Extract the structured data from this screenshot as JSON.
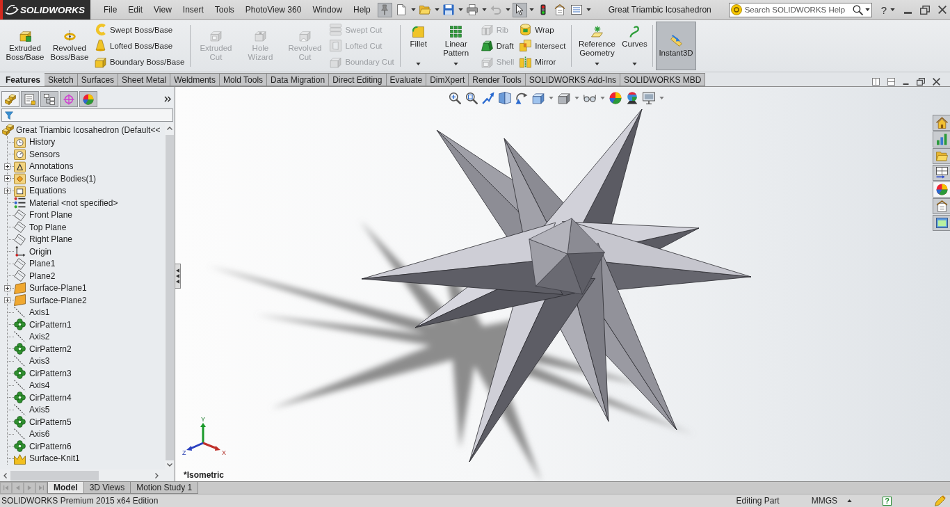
{
  "title_bar": {
    "logo": "SOLIDWORKS",
    "menu": [
      "File",
      "Edit",
      "View",
      "Insert",
      "Tools",
      "PhotoView 360",
      "Window",
      "Help"
    ],
    "quick_access": [
      {
        "selected": true,
        "disabled": false,
        "dropdown": false
      },
      {
        "selected": false,
        "disabled": false,
        "dropdown": true
      },
      {
        "selected": false,
        "disabled": false,
        "dropdown": true
      },
      {
        "selected": false,
        "disabled": false,
        "dropdown": true
      },
      {
        "selected": false,
        "disabled": false,
        "dropdown": true
      },
      {
        "selected": false,
        "disabled": true,
        "dropdown": true
      },
      {
        "selected": true,
        "disabled": false,
        "dropdown": true
      },
      {
        "selected": false,
        "disabled": false,
        "dropdown": false
      },
      {
        "selected": false,
        "disabled": false,
        "dropdown": false
      },
      {
        "selected": false,
        "disabled": false,
        "dropdown": true
      }
    ],
    "document_title": "Great Triambic Icosahedron",
    "search": {
      "placeholder": "Search SOLIDWORKS Help"
    },
    "help_glyph": "?"
  },
  "ribbon": {
    "groups": [
      {
        "columns": [
          {
            "kind": "large",
            "label": "Extruded Boss/Base",
            "disabled": false,
            "dropdown": false
          },
          {
            "kind": "large",
            "label": "Revolved Boss/Base",
            "disabled": false,
            "dropdown": false
          },
          {
            "kind": "stack",
            "items": [
              {
                "label": "Swept Boss/Base",
                "disabled": false
              },
              {
                "label": "Lofted Boss/Base",
                "disabled": false
              },
              {
                "label": "Boundary Boss/Base",
                "disabled": false
              }
            ]
          }
        ]
      },
      {
        "columns": [
          {
            "kind": "large",
            "label": "Extruded Cut",
            "disabled": true,
            "dropdown": false
          },
          {
            "kind": "large",
            "label": "Hole Wizard",
            "disabled": true,
            "dropdown": false
          },
          {
            "kind": "large",
            "label": "Revolved Cut",
            "disabled": true,
            "dropdown": false
          },
          {
            "kind": "stack",
            "items": [
              {
                "label": "Swept Cut",
                "disabled": true
              },
              {
                "label": "Lofted Cut",
                "disabled": true
              },
              {
                "label": "Boundary Cut",
                "disabled": true
              }
            ]
          }
        ]
      },
      {
        "columns": [
          {
            "kind": "large",
            "label": "Fillet",
            "disabled": false,
            "dropdown": true
          },
          {
            "kind": "large",
            "label": "Linear Pattern",
            "disabled": false,
            "dropdown": true
          },
          {
            "kind": "stack",
            "items": [
              {
                "label": "Rib",
                "disabled": true
              },
              {
                "label": "Draft",
                "disabled": false
              },
              {
                "label": "Shell",
                "disabled": true
              }
            ]
          },
          {
            "kind": "stack",
            "items": [
              {
                "label": "Wrap",
                "disabled": false
              },
              {
                "label": "Intersect",
                "disabled": false
              },
              {
                "label": "Mirror",
                "disabled": false
              }
            ]
          }
        ]
      },
      {
        "columns": [
          {
            "kind": "large",
            "label": "Reference Geometry",
            "disabled": false,
            "dropdown": true
          },
          {
            "kind": "large",
            "label": "Curves",
            "disabled": false,
            "dropdown": true
          }
        ]
      },
      {
        "columns": [
          {
            "kind": "toggle",
            "label": "Instant3D",
            "disabled": false,
            "dropdown": false,
            "on": true
          }
        ]
      }
    ]
  },
  "command_tabs": [
    {
      "label": "Features",
      "selected": true
    },
    {
      "label": "Sketch",
      "selected": false
    },
    {
      "label": "Surfaces",
      "selected": false
    },
    {
      "label": "Sheet Metal",
      "selected": false
    },
    {
      "label": "Weldments",
      "selected": false
    },
    {
      "label": "Mold Tools",
      "selected": false
    },
    {
      "label": "Data Migration",
      "selected": false
    },
    {
      "label": "Direct Editing",
      "selected": false
    },
    {
      "label": "Evaluate",
      "selected": false
    },
    {
      "label": "DimXpert",
      "selected": false
    },
    {
      "label": "Render Tools",
      "selected": false
    },
    {
      "label": "SOLIDWORKS Add-Ins",
      "selected": false
    },
    {
      "label": "SOLIDWORKS MBD",
      "selected": false
    }
  ],
  "feature_panel": {
    "tabs": [
      {
        "selected": true
      },
      {
        "selected": false
      },
      {
        "selected": false
      },
      {
        "selected": false
      },
      {
        "selected": false
      }
    ],
    "tree": {
      "label": "Great Triambic Icosahedron (Default<<",
      "kind": "part",
      "children": [
        {
          "label": "History",
          "kind": "history"
        },
        {
          "label": "Sensors",
          "kind": "sensors"
        },
        {
          "label": "Annotations",
          "kind": "annotations",
          "expanded": false
        },
        {
          "label": "Surface Bodies(1)",
          "kind": "bodies",
          "expanded": false
        },
        {
          "label": "Equations",
          "kind": "equations",
          "expanded": false
        },
        {
          "label": "Material <not specified>",
          "kind": "material"
        },
        {
          "label": "Front Plane",
          "kind": "plane"
        },
        {
          "label": "Top Plane",
          "kind": "plane"
        },
        {
          "label": "Right Plane",
          "kind": "plane"
        },
        {
          "label": "Origin",
          "kind": "origin"
        },
        {
          "label": "Plane1",
          "kind": "plane"
        },
        {
          "label": "Plane2",
          "kind": "plane"
        },
        {
          "label": "Surface-Plane1",
          "kind": "surface",
          "expanded": false
        },
        {
          "label": "Surface-Plane2",
          "kind": "surface",
          "expanded": false
        },
        {
          "label": "Axis1",
          "kind": "axis"
        },
        {
          "label": "CirPattern1",
          "kind": "pattern"
        },
        {
          "label": "Axis2",
          "kind": "axis"
        },
        {
          "label": "CirPattern2",
          "kind": "pattern"
        },
        {
          "label": "Axis3",
          "kind": "axis"
        },
        {
          "label": "CirPattern3",
          "kind": "pattern"
        },
        {
          "label": "Axis4",
          "kind": "axis"
        },
        {
          "label": "CirPattern4",
          "kind": "pattern"
        },
        {
          "label": "Axis5",
          "kind": "axis"
        },
        {
          "label": "CirPattern5",
          "kind": "pattern"
        },
        {
          "label": "Axis6",
          "kind": "axis"
        },
        {
          "label": "CirPattern6",
          "kind": "pattern"
        },
        {
          "label": "Surface-Knit1",
          "kind": "knit"
        }
      ]
    }
  },
  "graphics": {
    "view_toolbar": [
      {
        "dropdown": false
      },
      {
        "dropdown": false
      },
      {
        "dropdown": false
      },
      {
        "dropdown": false
      },
      {
        "dropdown": false
      },
      {
        "dropdown": true
      },
      {
        "dropdown": true
      },
      {
        "dropdown": true
      },
      {
        "dropdown": false
      },
      {
        "dropdown": false
      },
      {
        "dropdown": true
      }
    ],
    "task_pane": [
      {
        "selected": false
      },
      {
        "selected": false
      },
      {
        "selected": false
      },
      {
        "selected": false
      },
      {
        "selected": true
      },
      {
        "selected": false
      },
      {
        "selected": false
      }
    ],
    "triad": {
      "x": "X",
      "y": "Y",
      "z": "Z"
    },
    "view_label": "*Isometric"
  },
  "bottom_tabs": [
    {
      "label": "Model",
      "selected": true
    },
    {
      "label": "3D Views",
      "selected": false
    },
    {
      "label": "Motion Study 1",
      "selected": false
    }
  ],
  "status_bar": {
    "product": "SOLIDWORKS Premium 2015 x64 Edition",
    "mode": "Editing Part",
    "units": "MMGS",
    "help_glyph": "?"
  }
}
